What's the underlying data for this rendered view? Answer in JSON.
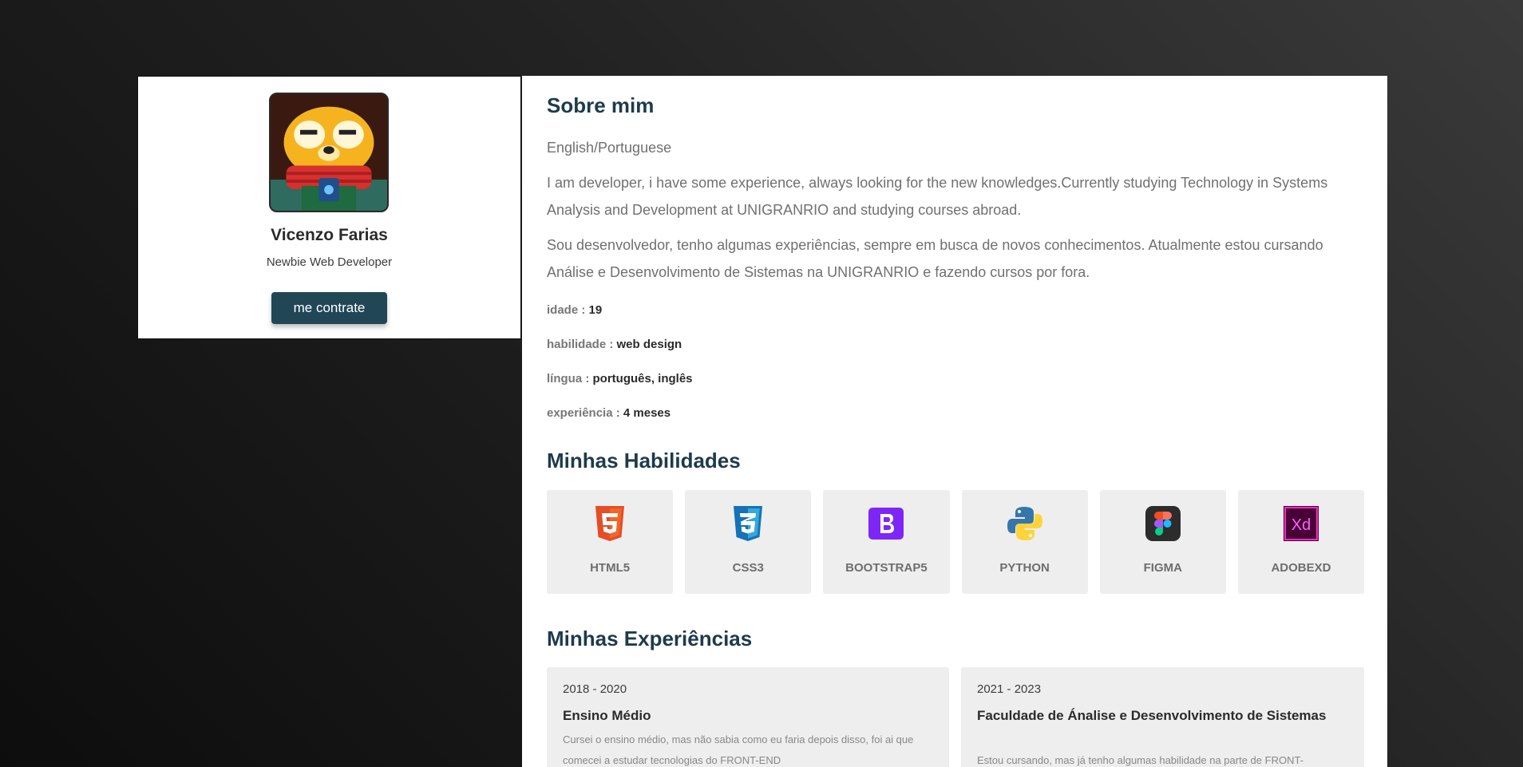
{
  "profile": {
    "name": "Vicenzo Farias",
    "role": "Newbie Web Developer",
    "hire_label": "me contrate"
  },
  "about": {
    "title": "Sobre mim",
    "languages_line": "English/Portuguese",
    "para_en": "I am developer, i have some experience, always looking for the new knowledges.Currently studying Technology in Systems Analysis and Development at UNIGRANRIO and studying courses abroad.",
    "para_pt": "Sou desenvolvedor, tenho algumas experiências, sempre em busca de novos conhecimentos. Atualmente estou cursando Análise e Desenvolvimento de Sistemas na UNIGRANRIO e fazendo cursos por fora.",
    "info": [
      {
        "key": "idade :",
        "value": "19"
      },
      {
        "key": "habilidade :",
        "value": "web design"
      },
      {
        "key": "língua :",
        "value": "português, inglês"
      },
      {
        "key": "experiência :",
        "value": "4 meses"
      }
    ]
  },
  "skills": {
    "title": "Minhas Habilidades",
    "items": [
      {
        "label": "HTML5",
        "icon": "html5-icon",
        "color": "#e44d26"
      },
      {
        "label": "CSS3",
        "icon": "css3-icon",
        "color": "#1572b6"
      },
      {
        "label": "BOOTSTRAP5",
        "icon": "bootstrap-icon",
        "color": "#7952b3"
      },
      {
        "label": "PYTHON",
        "icon": "python-icon",
        "color": "#3776ab"
      },
      {
        "label": "FIGMA",
        "icon": "figma-icon",
        "color": "#2c2c2c"
      },
      {
        "label": "ADOBEXD",
        "icon": "adobexd-icon",
        "color": "#ff2bc2"
      }
    ]
  },
  "experiences": {
    "title": "Minhas Experiências",
    "items": [
      {
        "period": "2018 - 2020",
        "title": "Ensino Médio",
        "desc": "Cursei o ensino médio, mas não sabia como eu faria depois disso, foi ai que comecei a estudar tecnologias do FRONT-END"
      },
      {
        "period": "2021 - 2023",
        "title": "Faculdade de Ánalise e Desenvolvimento de Sistemas",
        "desc": "Estou cursando, mas já tenho algumas habilidade na parte de FRONT-"
      }
    ]
  },
  "colors": {
    "accent": "#214757",
    "heading": "#1d3b4c"
  }
}
